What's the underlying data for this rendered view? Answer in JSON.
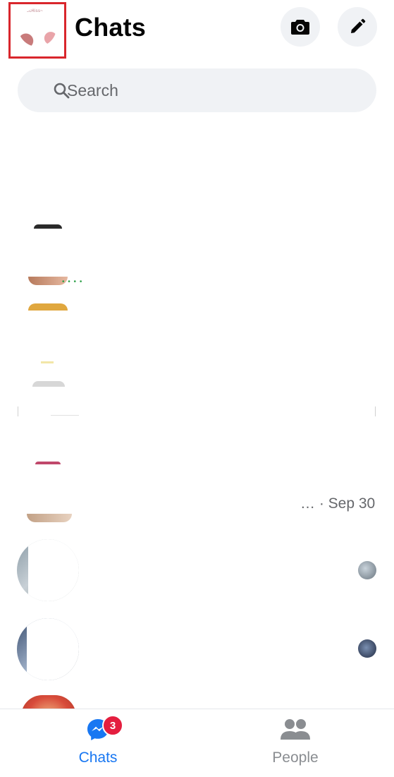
{
  "header": {
    "title": "Chats",
    "profile_avatar_text": "~ccRiss~"
  },
  "search": {
    "placeholder": "Search"
  },
  "chat_list": {
    "rows": [
      {
        "meta": "… · Sep 30"
      }
    ]
  },
  "bottom_nav": {
    "tabs": [
      {
        "label": "Chats",
        "badge": "3",
        "active": true
      },
      {
        "label": "People",
        "active": false
      }
    ]
  },
  "colors": {
    "accent": "#1877f2",
    "badge": "#e41e3f",
    "highlight_box": "#d9262c",
    "muted_text": "#65676b",
    "button_bg": "#f0f2f5"
  },
  "icons": [
    "search-icon",
    "camera-icon",
    "pencil-icon",
    "chat-bubble-icon",
    "people-icon"
  ]
}
